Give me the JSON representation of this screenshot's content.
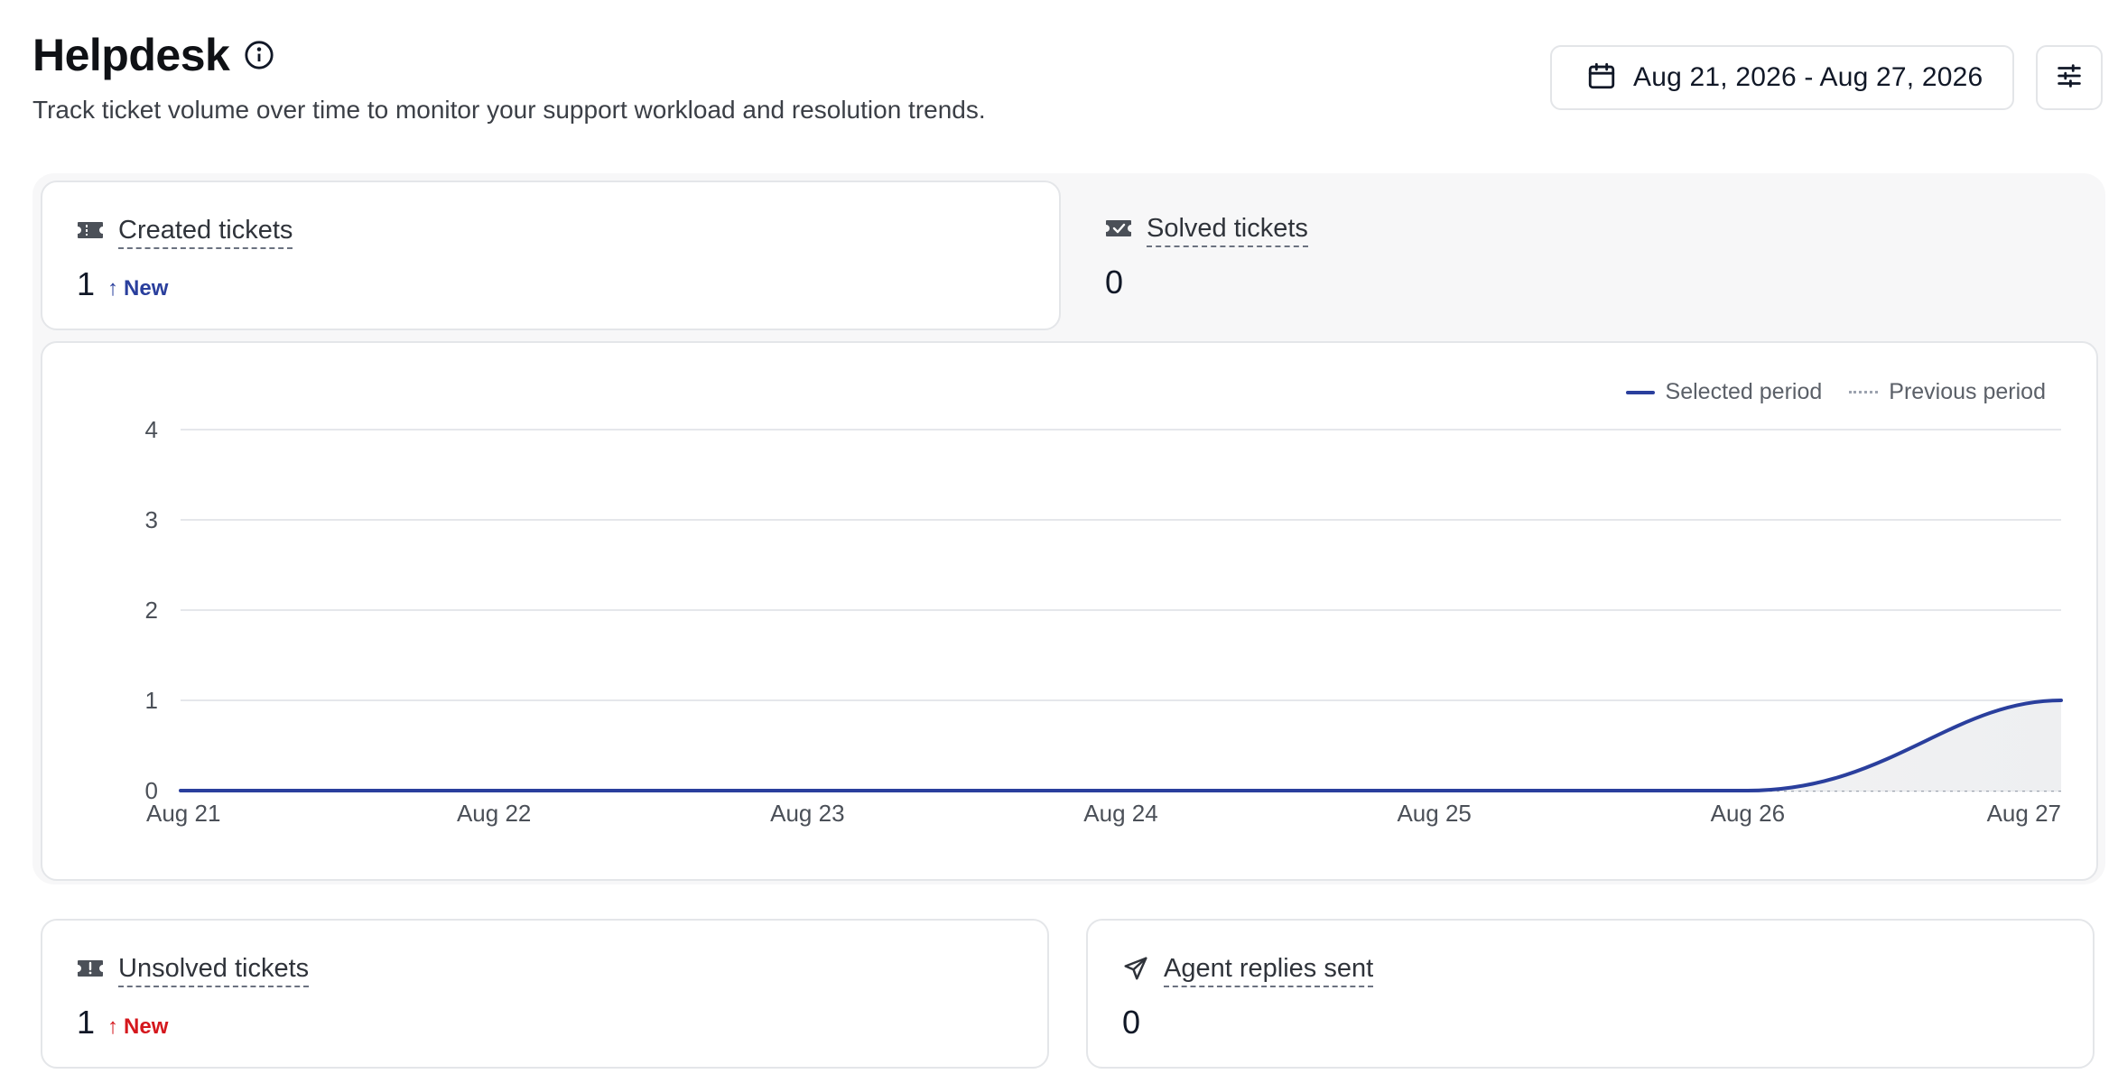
{
  "header": {
    "title": "Helpdesk",
    "info_icon": "info-icon",
    "subtitle": "Track ticket volume over time to monitor your support workload and resolution trends."
  },
  "toolbar": {
    "date_range_icon": "calendar-icon",
    "date_range": "Aug 21, 2026 - Aug 27, 2026",
    "filter_icon": "sliders-icon"
  },
  "metrics": {
    "created": {
      "icon": "ticket-icon",
      "label": "Created tickets",
      "value": "1",
      "delta_arrow": "↑",
      "delta": "New",
      "selected": true
    },
    "solved": {
      "icon": "ticket-check-icon",
      "label": "Solved tickets",
      "value": "0"
    },
    "unsolved": {
      "icon": "ticket-alert-icon",
      "label": "Unsolved tickets",
      "value": "1",
      "delta_arrow": "↑",
      "delta": "New"
    },
    "replies": {
      "icon": "send-icon",
      "label": "Agent replies sent",
      "value": "0"
    }
  },
  "colors": {
    "accent": "#2a3f9d",
    "negative": "#d5171d",
    "grid": "#e5e7eb",
    "previous": "#9ca3af"
  },
  "chart_data": {
    "type": "line",
    "x": [
      "Aug 21",
      "Aug 22",
      "Aug 23",
      "Aug 24",
      "Aug 25",
      "Aug 26",
      "Aug 27"
    ],
    "series": [
      {
        "name": "Selected period",
        "values": [
          0,
          0,
          0,
          0,
          0,
          0,
          1
        ],
        "style": "solid",
        "color": "#2a3f9d"
      },
      {
        "name": "Previous period",
        "values": [
          0,
          0,
          0,
          0,
          0,
          0,
          0
        ],
        "style": "dotted",
        "color": "#9ca3af"
      }
    ],
    "yticks": [
      "0",
      "1",
      "2",
      "3",
      "4"
    ],
    "ylim": [
      0,
      4
    ],
    "grid": true,
    "legend_position": "top-right"
  }
}
